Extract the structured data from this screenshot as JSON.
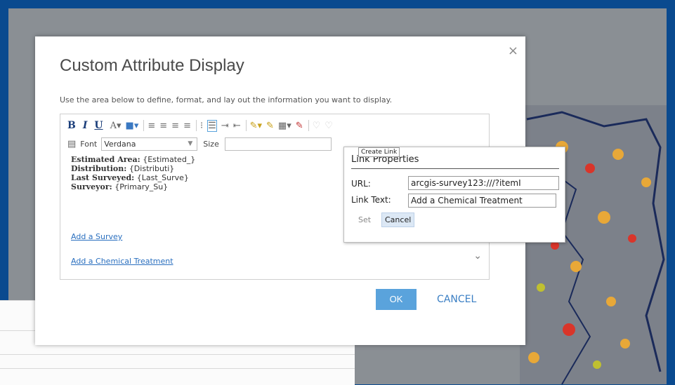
{
  "dialog": {
    "title": "Custom Attribute Display",
    "description": "Use the area below to define, format, and lay out the information you want to display.",
    "close_glyph": "×",
    "ok_label": "OK",
    "cancel_label": "CANCEL"
  },
  "toolbar": {
    "bold": "B",
    "italic": "I",
    "underline": "U",
    "font_label": "Font",
    "font_value": "Verdana",
    "size_label": "Size",
    "size_value": ""
  },
  "content": {
    "lines": [
      {
        "label": "Estimated Area:",
        "value": "{Estimated_}"
      },
      {
        "label": "Distribution:",
        "value": "{Distributi}"
      },
      {
        "label": "Last Surveyed:",
        "value": "{Last_Surve}"
      },
      {
        "label": "Surveyor:",
        "value": "{Primary_Su}"
      }
    ],
    "links": [
      "Add a Survey",
      "Add a Chemical Treatment"
    ]
  },
  "link_popup": {
    "title": "Link Properties",
    "url_label": "URL:",
    "url_value": "arcgis-survey123:///?itemI",
    "text_label": "Link Text:",
    "text_value": "Add a Chemical Treatment",
    "set_label": "Set",
    "cancel_label": "Cancel"
  },
  "tooltip": "Create Link",
  "colors": {
    "frame": "#0a4a8f",
    "accent": "#5aa3dc",
    "link": "#2a6fbf"
  }
}
